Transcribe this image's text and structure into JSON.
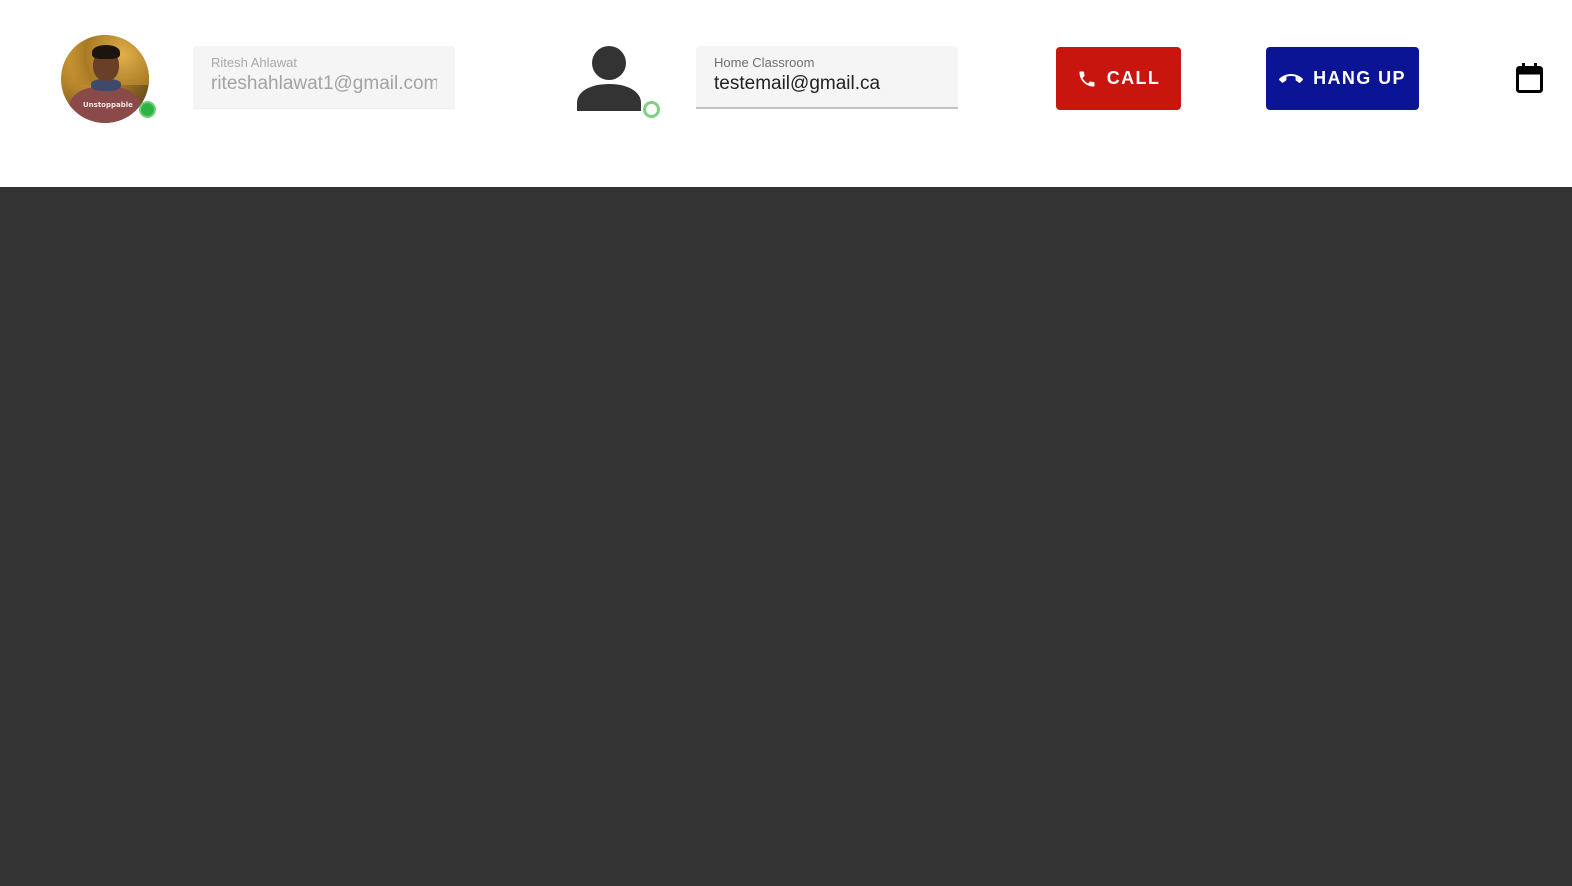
{
  "local_user": {
    "avatar": "profile-photo",
    "status": "online",
    "name_label": "Ritesh Ahlawat",
    "email": "riteshahlawat1@gmail.com",
    "avatar_shirt_text": "Unstoppable"
  },
  "remote_user": {
    "icon": "person-icon",
    "status": "available",
    "name_label": "Home Classroom",
    "email": "testemail@gmail.ca"
  },
  "actions": {
    "call_label": "CALL",
    "call_icon": "phone-icon",
    "call_color": "#c8150d",
    "hangup_label": "HANG UP",
    "hangup_icon": "call-end-icon",
    "hangup_color": "#0b1494"
  },
  "toolbar": {
    "calendar_icon": "calendar-icon"
  },
  "colors": {
    "stage_background": "#333333",
    "header_background": "#ffffff",
    "online_status": "#2fb344",
    "available_status": "#7fcf86"
  }
}
